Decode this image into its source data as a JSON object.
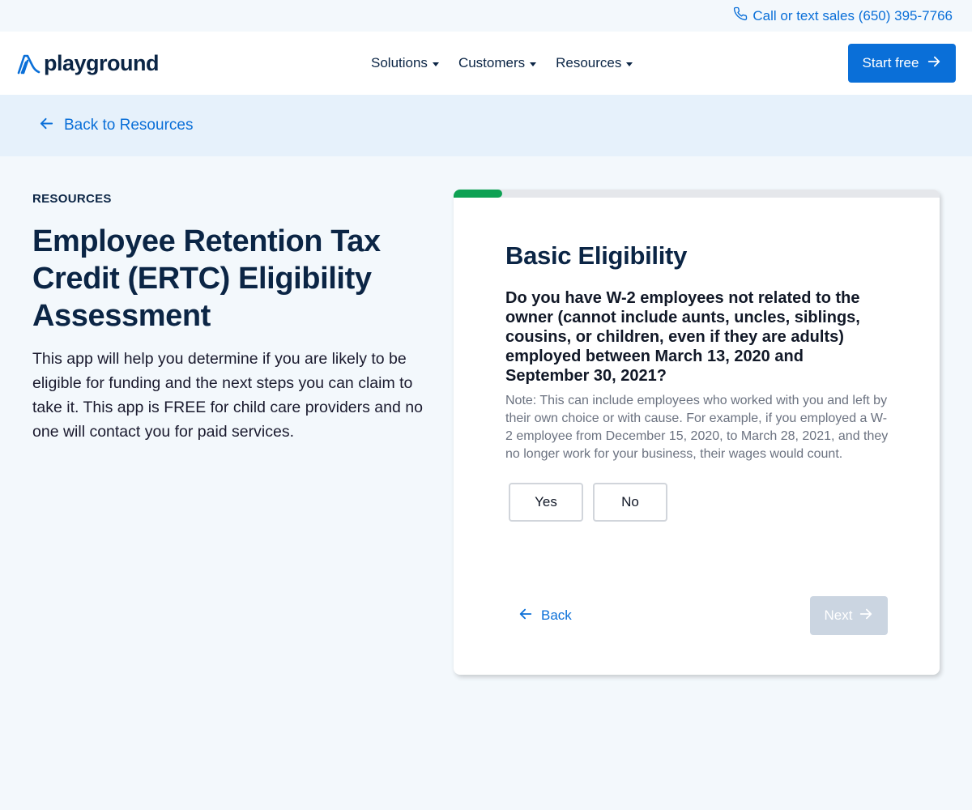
{
  "topbar": {
    "phone_text": "Call or text sales (650) 395-7766",
    "icon": "phone-icon"
  },
  "nav": {
    "logo_text": "playground",
    "menu": [
      {
        "label": "Solutions"
      },
      {
        "label": "Customers"
      },
      {
        "label": "Resources"
      }
    ],
    "cta_label": "Start free"
  },
  "backbar": {
    "label": "Back to Resources"
  },
  "left": {
    "eyebrow": "RESOURCES",
    "title": "Employee Retention Tax Credit (ERTC) Eligibility Assessment",
    "description": "This app will help you determine if you are likely to be eligible for funding and the next steps you can claim to take it. This app is FREE for child care providers and no one will contact you for paid services."
  },
  "card": {
    "progress_fraction": 0.1,
    "title": "Basic Eligibility",
    "question": "Do you have W-2 employees not related to the owner (cannot include aunts, uncles, siblings, cousins, or children, even if they are adults) employed between March 13, 2020 and September 30, 2021?",
    "note": "Note: This can include employees who worked with you and left by their own choice or with cause. For example, if you employed a W-2 employee from December 15, 2020, to March 28, 2021, and they no longer work for your business, their wages would count.",
    "answers": [
      {
        "label": "Yes"
      },
      {
        "label": "No"
      }
    ],
    "back_label": "Back",
    "next_label": "Next",
    "next_disabled": true
  },
  "colors": {
    "brand_blue": "#0a6fd8",
    "progress_green": "#0ea153",
    "navy": "#0b2545",
    "disabled": "#cbd5e1"
  }
}
